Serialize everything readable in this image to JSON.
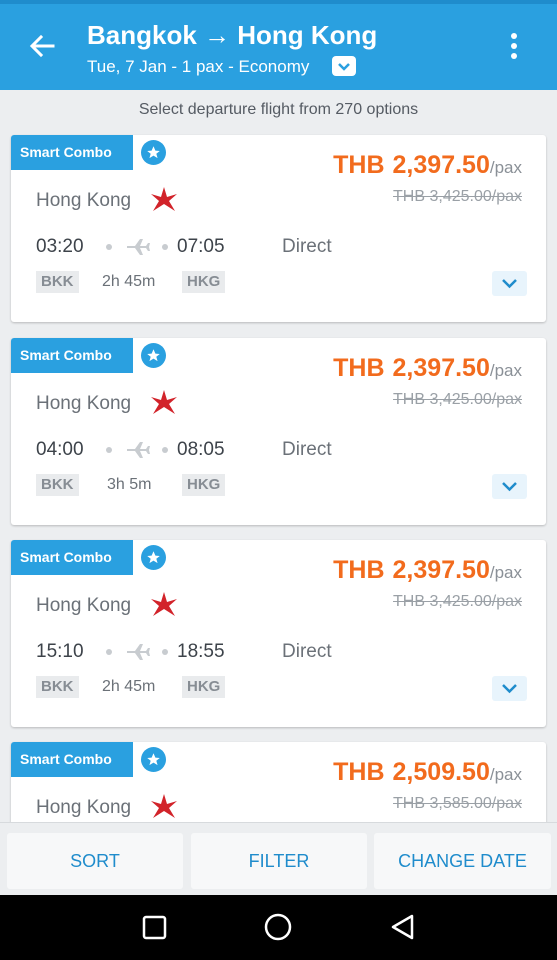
{
  "header": {
    "title": "Bangkok → Hong Kong",
    "subtitle": "Tue, 7 Jan - 1 pax - Economy",
    "back_icon": "arrow-left-icon",
    "more_icon": "more-vertical-icon",
    "dropdown_icon": "chevron-down-icon"
  },
  "subheader": "Select departure flight from 270 options",
  "flights": [
    {
      "badge": "Smart Combo",
      "currency": "THB",
      "price": "2,397.50",
      "per": "/pax",
      "old_price": "THB  3,425.00/pax",
      "airline": "Hong Kong",
      "dep_time": "03:20",
      "arr_time": "07:05",
      "stops": "Direct",
      "from": "BKK",
      "duration": "2h 45m",
      "to": "HKG"
    },
    {
      "badge": "Smart Combo",
      "currency": "THB",
      "price": "2,397.50",
      "per": "/pax",
      "old_price": "THB  3,425.00/pax",
      "airline": "Hong Kong",
      "dep_time": "04:00",
      "arr_time": "08:05",
      "stops": "Direct",
      "from": "BKK",
      "duration": "3h 5m",
      "to": "HKG"
    },
    {
      "badge": "Smart Combo",
      "currency": "THB",
      "price": "2,397.50",
      "per": "/pax",
      "old_price": "THB  3,425.00/pax",
      "airline": "Hong Kong",
      "dep_time": "15:10",
      "arr_time": "18:55",
      "stops": "Direct",
      "from": "BKK",
      "duration": "2h 45m",
      "to": "HKG"
    },
    {
      "badge": "Smart Combo",
      "currency": "THB",
      "price": "2,509.50",
      "per": "/pax",
      "old_price": "THB  3,585.00/pax",
      "airline": "Hong Kong"
    }
  ],
  "actions": {
    "sort": "SORT",
    "filter": "FILTER",
    "change_date": "CHANGE DATE"
  },
  "colors": {
    "primary": "#2aa0e0",
    "price": "#f26b1d",
    "airline_logo": "#d2232a"
  },
  "system_nav": [
    "recent-apps-icon",
    "home-icon",
    "back-icon"
  ]
}
